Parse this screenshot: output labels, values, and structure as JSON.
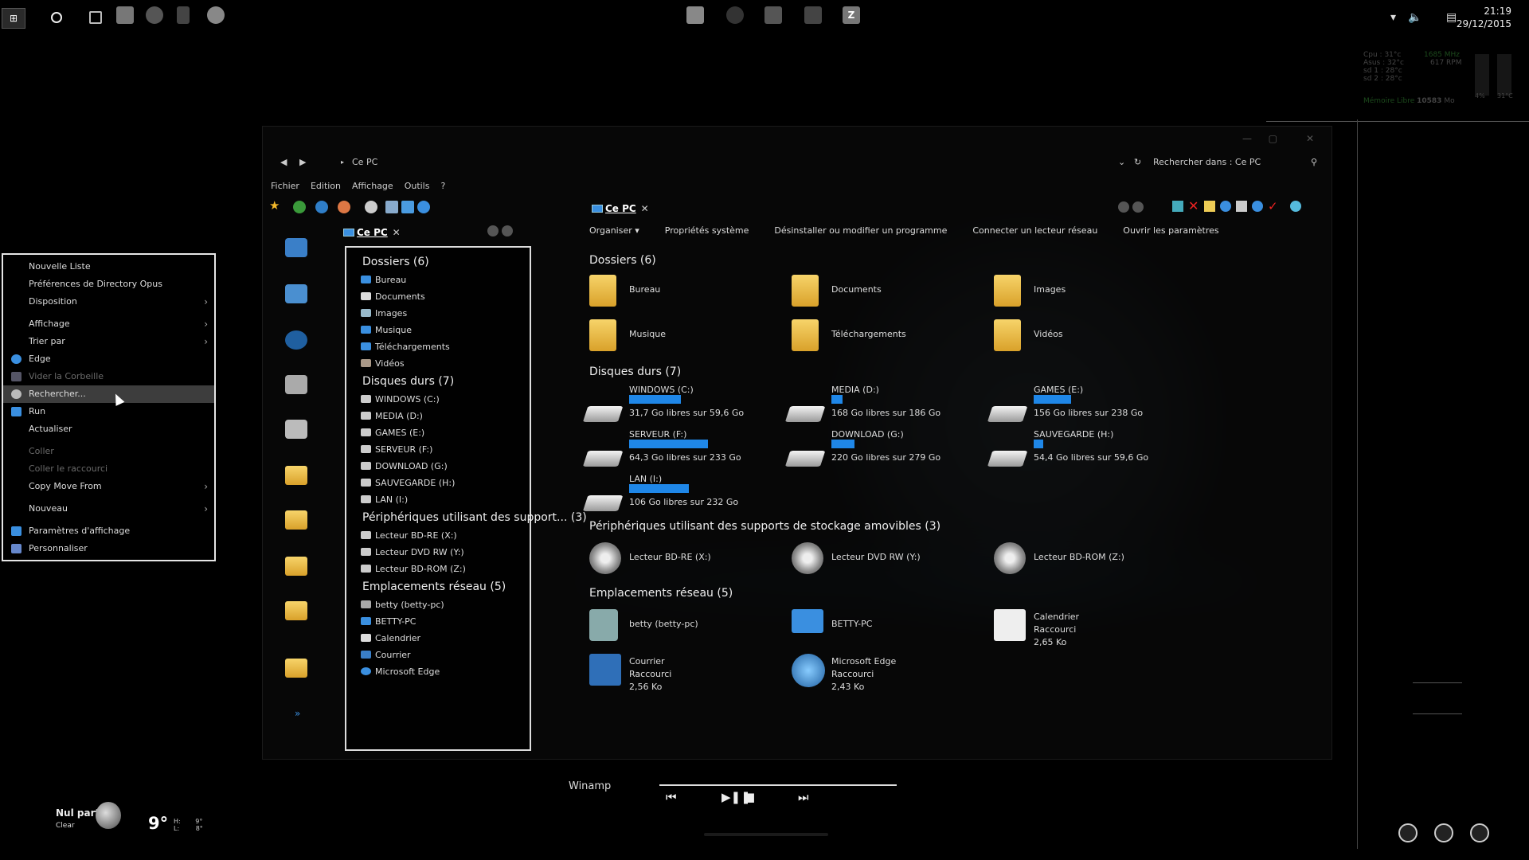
{
  "taskbar": {
    "clock_time": "21:19",
    "clock_date": "29/12/2015"
  },
  "sysmon": {
    "lines": [
      "Cpu :  31°c",
      "Asus : 32°c",
      "sd 1 :  28°c",
      "sd 2 :  28°c"
    ],
    "mhz": "1685 MHz",
    "rpm": "617 RPM",
    "mem_label": "Mémoire Libre",
    "mem_value": "10583",
    "mem_unit": "Mo",
    "bar1": "4%",
    "bar2": "31°C"
  },
  "explorer": {
    "address": "Ce PC",
    "search_placeholder": "Rechercher dans : Ce PC",
    "menu": [
      "Fichier",
      "Edition",
      "Affichage",
      "Outils",
      "?"
    ],
    "tab_label": "Ce PC",
    "tab_close": "✕",
    "commands": [
      "Organiser ▾",
      "Propriétés système",
      "Désinstaller ou modifier un programme",
      "Connecter un lecteur réseau",
      "Ouvrir les paramètres"
    ],
    "tree": {
      "folders_title": "Dossiers (6)",
      "folders": [
        "Bureau",
        "Documents",
        "Images",
        "Musique",
        "Téléchargements",
        "Vidéos"
      ],
      "drives_title": "Disques durs (7)",
      "drives": [
        "WINDOWS (C:)",
        "MEDIA (D:)",
        "GAMES (E:)",
        "SERVEUR (F:)",
        "DOWNLOAD (G:)",
        "SAUVEGARDE (H:)",
        "LAN (I:)"
      ],
      "removable_title": "Périphériques utilisant des support... (3)",
      "removable": [
        "Lecteur BD-RE (X:)",
        "Lecteur DVD RW (Y:)",
        "Lecteur BD-ROM (Z:)"
      ],
      "network_title": "Emplacements réseau (5)",
      "network": [
        "betty (betty-pc)",
        "BETTY-PC",
        "Calendrier",
        "Courrier",
        "Microsoft Edge"
      ]
    },
    "content": {
      "folders_title": "Dossiers (6)",
      "folders": [
        "Bureau",
        "Documents",
        "Images",
        "Musique",
        "Téléchargements",
        "Vidéos"
      ],
      "drives_title": "Disques durs (7)",
      "drives": [
        {
          "name": "WINDOWS (C:)",
          "free": "31,7 Go libres sur 59,6 Go",
          "used_fraction": 0.47
        },
        {
          "name": "MEDIA (D:)",
          "free": "168 Go libres sur 186 Go",
          "used_fraction": 0.1
        },
        {
          "name": "GAMES (E:)",
          "free": "156 Go libres sur 238 Go",
          "used_fraction": 0.34
        },
        {
          "name": "SERVEUR (F:)",
          "free": "64,3 Go libres sur 233 Go",
          "used_fraction": 0.72
        },
        {
          "name": "DOWNLOAD (G:)",
          "free": "220 Go libres sur 279 Go",
          "used_fraction": 0.21
        },
        {
          "name": "SAUVEGARDE (H:)",
          "free": "54,4 Go libres sur 59,6 Go",
          "used_fraction": 0.09
        },
        {
          "name": "LAN (I:)",
          "free": "106 Go libres sur 232 Go",
          "used_fraction": 0.54
        }
      ],
      "removable_title": "Périphériques utilisant des supports de stockage amovibles (3)",
      "removable": [
        "Lecteur BD-RE (X:)",
        "Lecteur DVD RW (Y:)",
        "Lecteur BD-ROM (Z:)"
      ],
      "network_title": "Emplacements réseau (5)",
      "network": [
        {
          "name": "betty (betty-pc)",
          "l2": "",
          "l3": ""
        },
        {
          "name": "BETTY-PC",
          "l2": "",
          "l3": ""
        },
        {
          "name": "Calendrier",
          "l2": "Raccourci",
          "l3": "2,65 Ko"
        },
        {
          "name": "Courrier",
          "l2": "Raccourci",
          "l3": "2,56 Ko"
        },
        {
          "name": "Microsoft Edge",
          "l2": "Raccourci",
          "l3": "2,43 Ko"
        }
      ]
    }
  },
  "context_menu": {
    "items": [
      {
        "label": "Nouvelle Liste"
      },
      {
        "label": "Préférences de Directory Opus"
      },
      {
        "label": "Disposition"
      },
      {
        "label": "Affichage"
      },
      {
        "label": "Trier par"
      },
      {
        "label": "Edge"
      },
      {
        "label": "Vider la Corbeille"
      },
      {
        "label": "Rechercher..."
      },
      {
        "label": "Run"
      },
      {
        "label": "Actualiser"
      },
      {
        "label": "Coller"
      },
      {
        "label": "Coller le raccourci"
      },
      {
        "label": "Copy Move From"
      },
      {
        "label": "Nouveau"
      },
      {
        "label": "Paramètres d'affichage"
      },
      {
        "label": "Personnaliser"
      }
    ]
  },
  "winamp": {
    "title": "Winamp"
  },
  "weather": {
    "location": "Nul part",
    "condition": "Clear",
    "temp": "9°",
    "h_label": "H:",
    "l_label": "L:",
    "high": "9°",
    "low": "8°"
  },
  "colors": {
    "accent": "#1f87e8",
    "background": "#000000"
  }
}
